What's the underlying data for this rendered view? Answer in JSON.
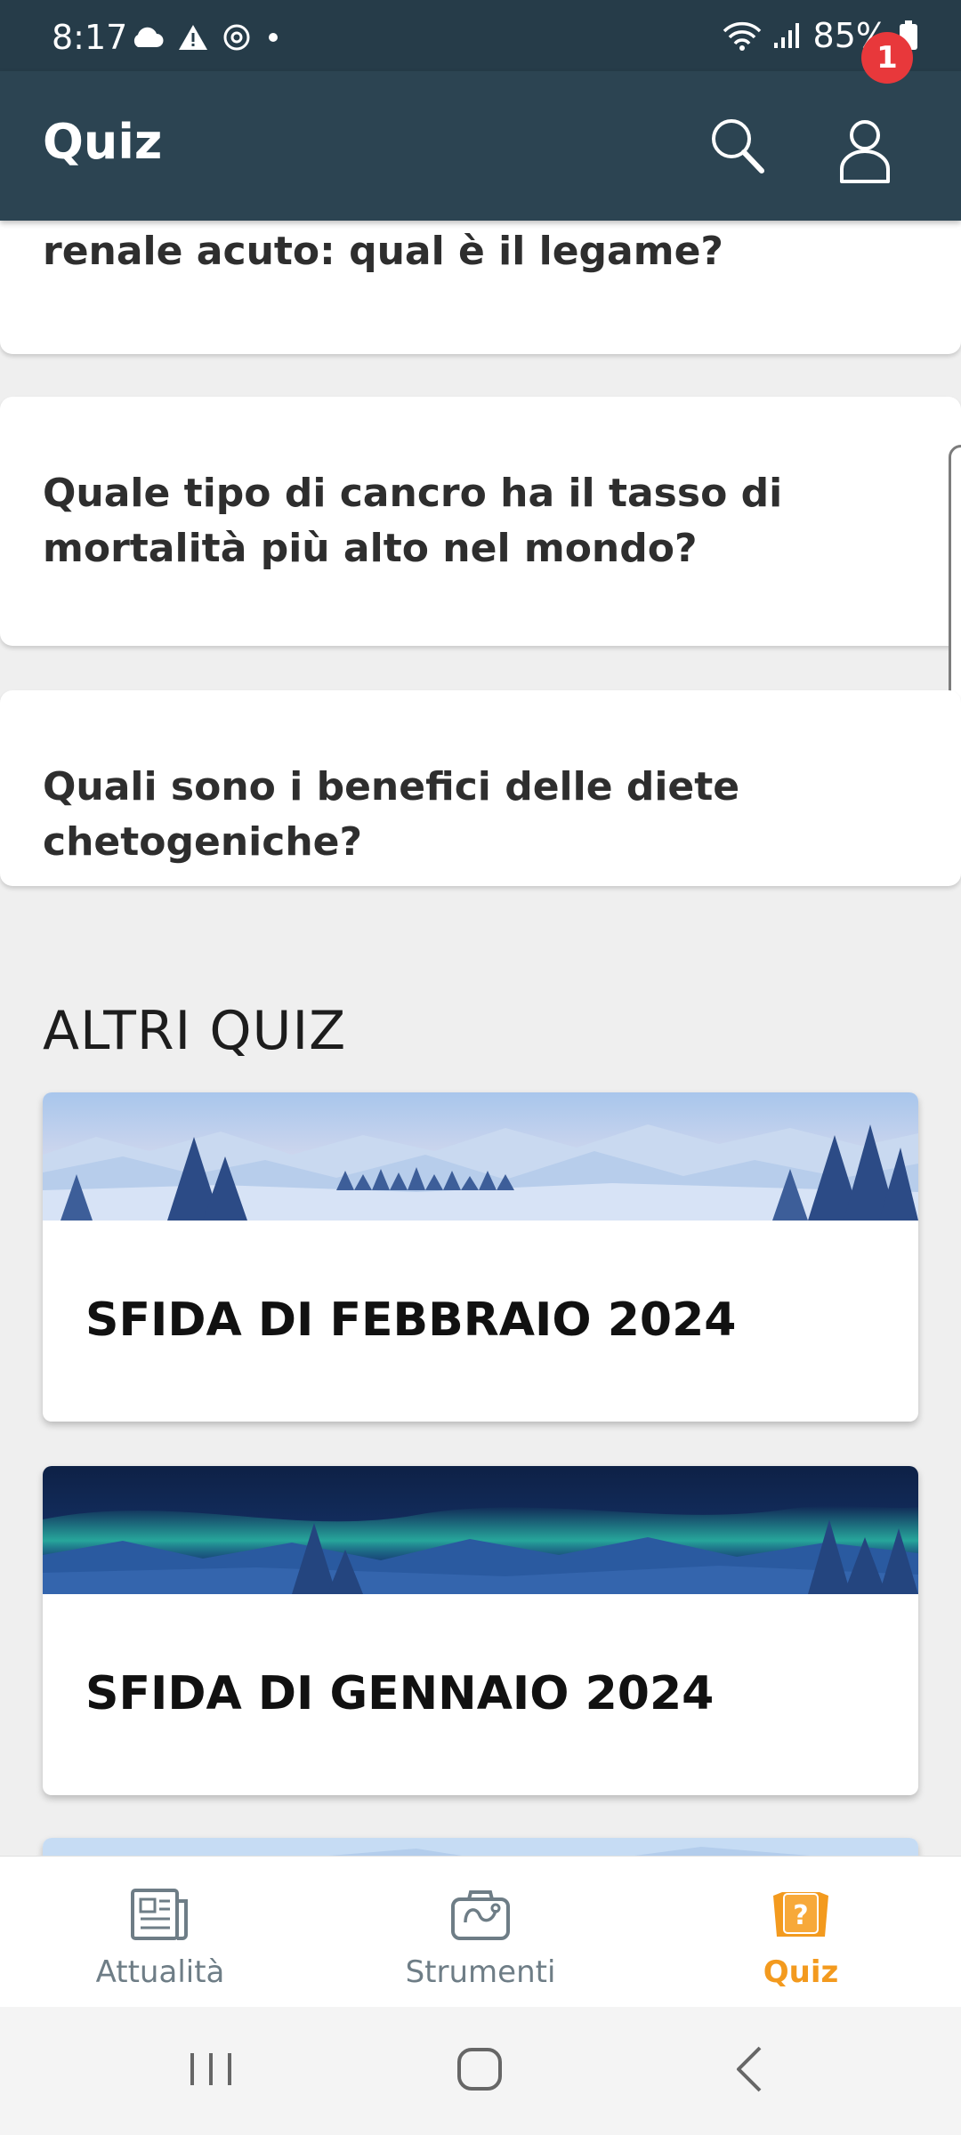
{
  "status": {
    "time": "8:17",
    "battery": "85%"
  },
  "app_bar": {
    "title": "Quiz",
    "notification_count": "1"
  },
  "questions": [
    {
      "text": "renale acuto: qual è il legame?"
    },
    {
      "text": "Quale tipo di cancro ha il tasso di mortalità più alto nel mondo?"
    },
    {
      "text": "Quali sono i benefici delle diete chetogeniche?"
    }
  ],
  "other_quizzes": {
    "heading": "ALTRI QUIZ",
    "items": [
      {
        "title": "SFIDA DI FEBBRAIO 2024"
      },
      {
        "title": "SFIDA DI GENNAIO 2024"
      }
    ]
  },
  "bottom_nav": {
    "items": [
      {
        "label": "Attualità",
        "icon": "newspaper-icon"
      },
      {
        "label": "Strumenti",
        "icon": "medical-bag-icon"
      },
      {
        "label": "Quiz",
        "icon": "quiz-icon",
        "active": true
      }
    ]
  },
  "colors": {
    "app_bar": "#2c4452",
    "status_bar": "#263c49",
    "accent": "#f39a1e",
    "badge": "#e8383b"
  }
}
